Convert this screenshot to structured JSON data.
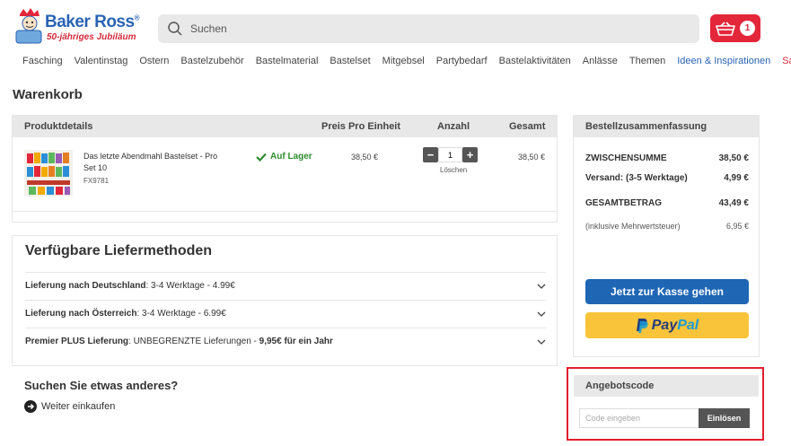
{
  "header": {
    "logo_name": "Baker Ross",
    "logo_reg": "®",
    "logo_sub": "50-jähriges Jubiläum",
    "search_placeholder": "Suchen",
    "cart_count": "1"
  },
  "nav": {
    "items": [
      "Fasching",
      "Valentinstag",
      "Ostern",
      "Bastelzubehör",
      "Bastelmaterial",
      "Bastelset",
      "Mitgebsel",
      "Partybedarf",
      "Bastelaktivitäten",
      "Anlässe",
      "Themen",
      "Ideen & Inspirationen",
      "Sale"
    ]
  },
  "page": {
    "title": "Warenkorb"
  },
  "cart": {
    "headers": {
      "product": "Produktdetails",
      "unit_price": "Preis Pro Einheit",
      "quantity": "Anzahl",
      "total": "Gesamt"
    },
    "item": {
      "name": "Das letzte Abendmahl Bastelset - Pro Set 10",
      "sku": "FX9781",
      "stock": "Auf Lager",
      "unit_price": "38,50 €",
      "quantity": "1",
      "remove": "Löschen",
      "total": "38,50 €"
    }
  },
  "delivery": {
    "title": "Verfügbare Liefermethoden",
    "rows": [
      {
        "label": "Lieferung nach Deutschland",
        "detail": ": 3-4 Werktage - 4.99€",
        "extra": ""
      },
      {
        "label": "Lieferung nach Österreich",
        "detail": ": 3-4 Werktage - 6.99€",
        "extra": ""
      },
      {
        "label": "Premier PLUS Lieferung",
        "detail": ": UNBEGRENZTE Lieferungen - ",
        "extra": "9,95€ für ein Jahr"
      }
    ]
  },
  "other": {
    "title": "Suchen Sie etwas anderes?",
    "continue": "Weiter einkaufen"
  },
  "summary": {
    "title": "Bestellzusammenfassung",
    "subtotal_label": "ZWISCHENSUMME",
    "subtotal": "38,50 €",
    "shipping_label": "Versand: (3-5 Werktage)",
    "shipping": "4,99 €",
    "total_label": "GESAMTBETRAG",
    "total": "43,49 €",
    "vat_label": "(inklusive Mehrwertsteuer)",
    "vat": "6,95 €",
    "checkout": "Jetzt zur Kasse gehen",
    "paypal_a": "Pay",
    "paypal_b": "Pal"
  },
  "promo": {
    "title": "Angebotscode",
    "placeholder": "Code eingeben",
    "button": "Einlösen"
  },
  "colors": {
    "brand_blue": "#2a63b4",
    "brand_red": "#e3263a",
    "checkout_blue": "#1f66b4",
    "paypal_yellow": "#f9c43a",
    "stock_green": "#2e8b2e",
    "highlight": "#e0202f"
  }
}
